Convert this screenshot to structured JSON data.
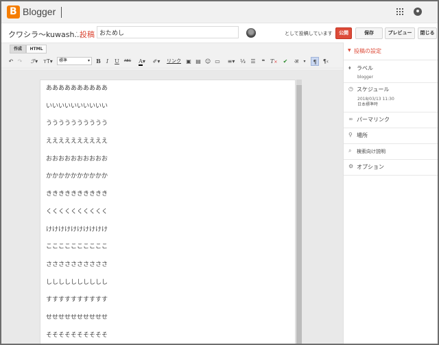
{
  "app": {
    "brand": "Blogger"
  },
  "title_row": {
    "blog_name": "クワシラ〜kuwash...",
    "crumb_separator": "·",
    "crumb_post": "投稿",
    "post_title": "おためし",
    "posting_as": "として投稿しています",
    "publish_label": "公開",
    "save_label": "保存",
    "preview_label": "プレビュー",
    "close_label": "閉じる"
  },
  "editor": {
    "tabs": [
      "作成",
      "HTML"
    ],
    "font_select": "標準",
    "link_label": "リンク",
    "toolbar_icons": [
      "undo-icon",
      "redo-icon",
      "font-family-icon",
      "font-size-icon",
      "bold-icon",
      "italic-icon",
      "underline-icon",
      "strikethrough-icon",
      "text-color-icon",
      "highlight-icon",
      "image-icon",
      "video-icon",
      "emoji-icon",
      "jump-break-icon",
      "align-icon",
      "numbered-list-icon",
      "bullet-list-icon",
      "quote-icon",
      "clear-format-icon",
      "spellcheck-icon",
      "input-tools-icon",
      "ltr-icon",
      "rtl-icon"
    ],
    "body_lines": [
      "ああああああああああ",
      "いいいいいいいいいい",
      "うううううううううう",
      "ええええええええええ",
      "おおおおおおおおおお",
      "かかかかかかかかかか",
      "きききききききききき",
      "くくくくくくくくくく",
      "けけけけけけけけけけ",
      "ここここここここここ",
      "ささささささささささ",
      "しししししししししし",
      "すすすすすすすすすす",
      "せせせせせせせせせせ",
      "そそそそそそそそそそ"
    ]
  },
  "sidebar": {
    "header": "投稿の設定",
    "labels": {
      "title": "ラベル",
      "value": "blogger"
    },
    "schedule": {
      "title": "スケジュール",
      "line1": "2018/03/13 11:30",
      "line2": "日本標準時"
    },
    "permalink": "パーマリンク",
    "location": "場所",
    "search_desc": "検索向け説明",
    "options": "オプション"
  },
  "colors": {
    "accent": "#dd4b39",
    "brand": "#f57d00",
    "toolbar_bg": "#f1f1f1",
    "editor_bg": "#e9e9e9"
  }
}
